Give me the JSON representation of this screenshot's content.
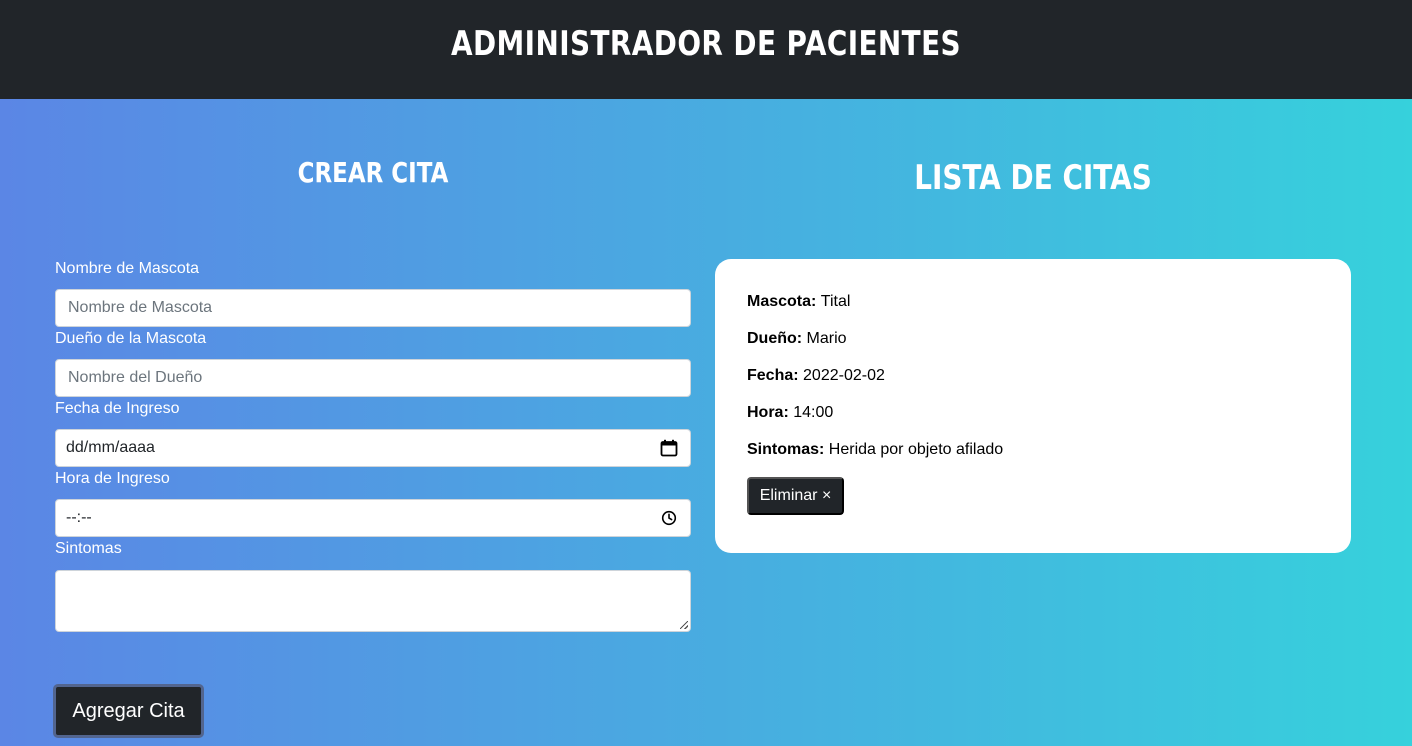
{
  "header": {
    "title": "Administrador de Pacientes"
  },
  "form": {
    "title": "Crear cita",
    "fields": {
      "mascota": {
        "label": "Nombre de Mascota",
        "placeholder": "Nombre de Mascota",
        "value": ""
      },
      "dueno": {
        "label": "Dueño de la Mascota",
        "placeholder": "Nombre del Dueño",
        "value": ""
      },
      "fecha": {
        "label": "Fecha de Ingreso",
        "value": "dd/mm/aaaa",
        "icon": "calendar-icon"
      },
      "hora": {
        "label": "Hora de Ingreso",
        "value": "--:--",
        "icon": "clock-icon"
      },
      "sintomas": {
        "label": "Sintomas",
        "value": ""
      }
    },
    "submit_label": "Agregar Cita"
  },
  "list": {
    "title": "Lista de citas",
    "appointments": [
      {
        "mascota_label": "Mascota:",
        "mascota": "Tital",
        "dueno_label": "Dueño:",
        "dueno": "Mario",
        "fecha_label": "Fecha:",
        "fecha": "2022-02-02",
        "hora_label": "Hora:",
        "hora": "14:00",
        "sintomas_label": "Sintomas:",
        "sintomas": "Herida por objeto afilado",
        "delete_label": "Eliminar ×"
      }
    ]
  },
  "colors": {
    "header_bg": "#212529",
    "gradient_start": "#5b86e5",
    "gradient_end": "#36d1dc",
    "button_bg": "#212529"
  }
}
